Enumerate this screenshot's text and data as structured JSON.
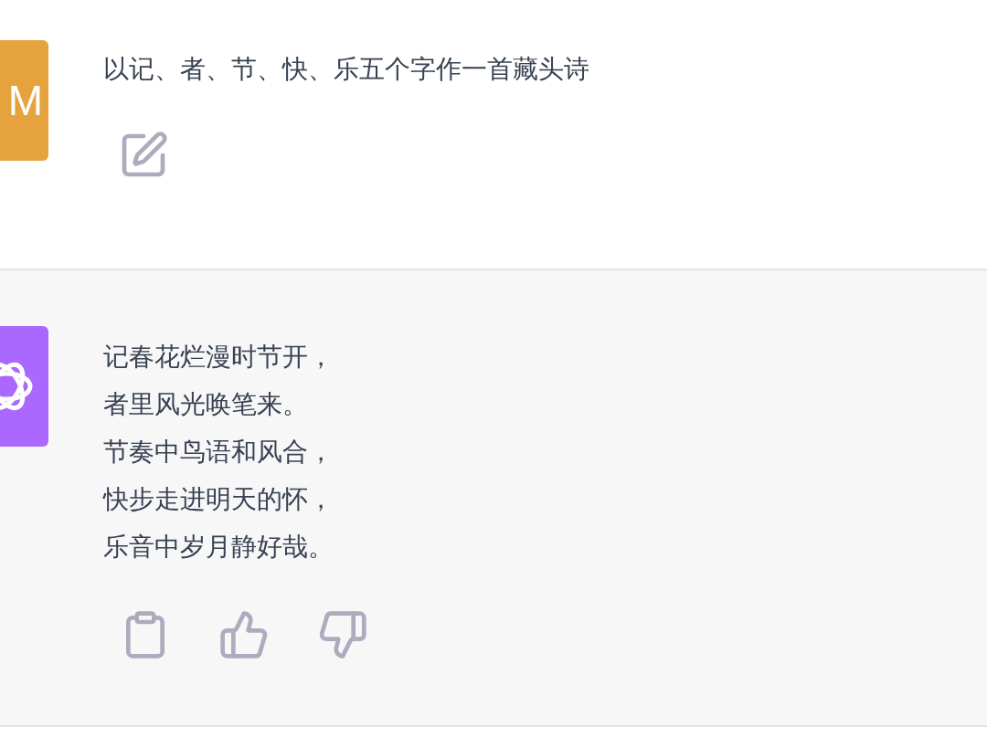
{
  "messages": [
    {
      "kind": "user",
      "avatar": "M",
      "lines": [
        "以记、者、节、快、乐五个字作一首藏头诗"
      ],
      "actions": [
        {
          "kind": "edit"
        }
      ]
    },
    {
      "kind": "assistant",
      "lines": [
        "记春花烂漫时节开，",
        "者里风光唤笔来。",
        "节奏中鸟语和风合，",
        "快步走进明天的怀，",
        "乐音中岁月静好哉。"
      ],
      "actions": [
        {
          "kind": "copy"
        },
        {
          "kind": "thumbs_up"
        },
        {
          "kind": "thumbs_down"
        }
      ]
    }
  ]
}
